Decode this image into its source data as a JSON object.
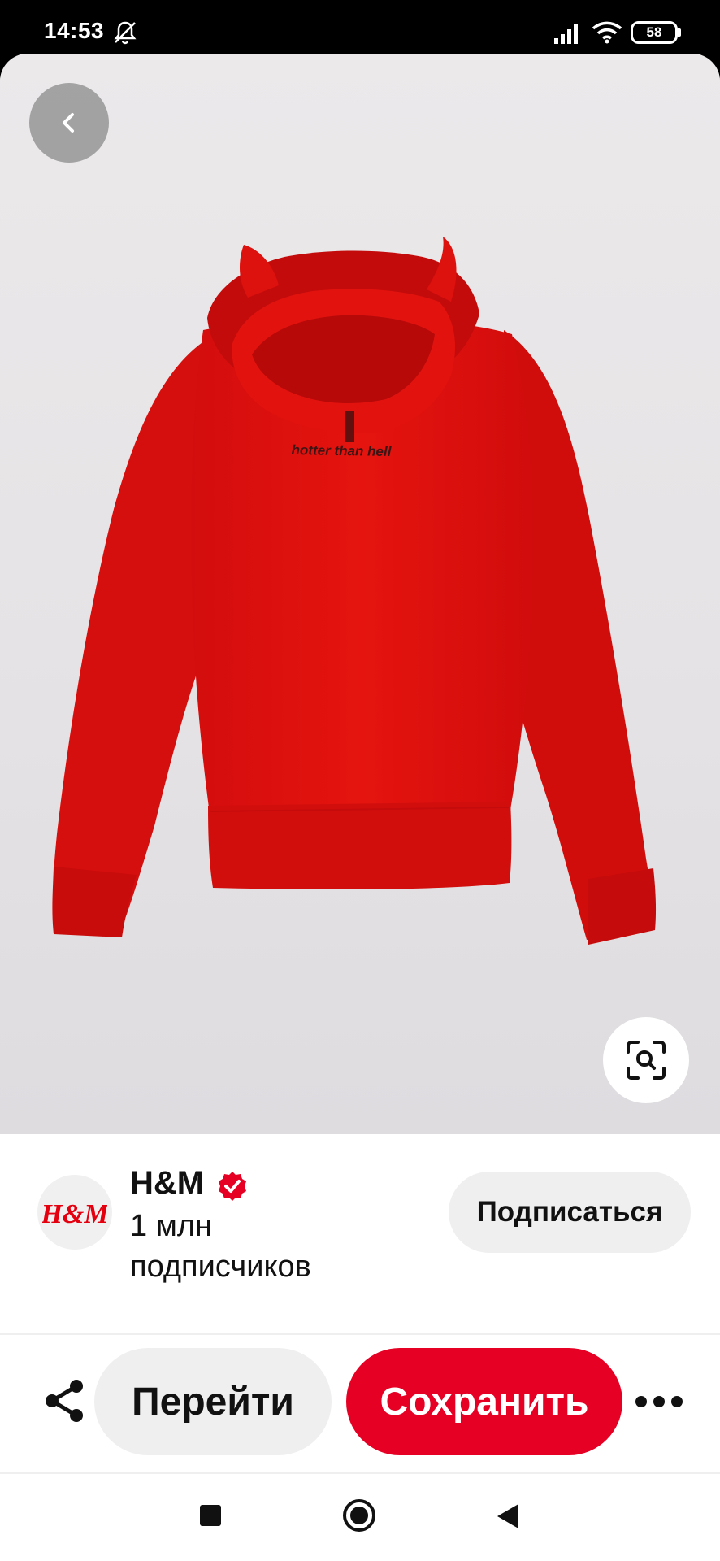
{
  "status_bar": {
    "time": "14:53",
    "battery": "58",
    "icons": [
      "bell-muted-icon",
      "signal-icon",
      "wifi-icon",
      "battery-icon"
    ]
  },
  "pin": {
    "image_description_icon": "hoodie-product-image",
    "print_text": "hotter than hell",
    "back_icon": "chevron-left-icon",
    "visual_search_icon": "lens-search-icon"
  },
  "creator": {
    "name": "H&M",
    "logo_text": "H&M",
    "verified_icon": "verified-check-icon",
    "followers": "1 млн подписчиков",
    "follow_label": "Подписаться"
  },
  "actions": {
    "share_icon": "share-icon",
    "visit_label": "Перейти",
    "save_label": "Сохранить",
    "more_icon": "more-dots-icon"
  },
  "nav": {
    "recents_icon": "square-icon",
    "home_icon": "circle-home-icon",
    "back_icon": "triangle-back-icon"
  },
  "colors": {
    "brand_red": "#e60023",
    "hoodie_red": "#e0110f",
    "button_grey": "#efefef"
  }
}
